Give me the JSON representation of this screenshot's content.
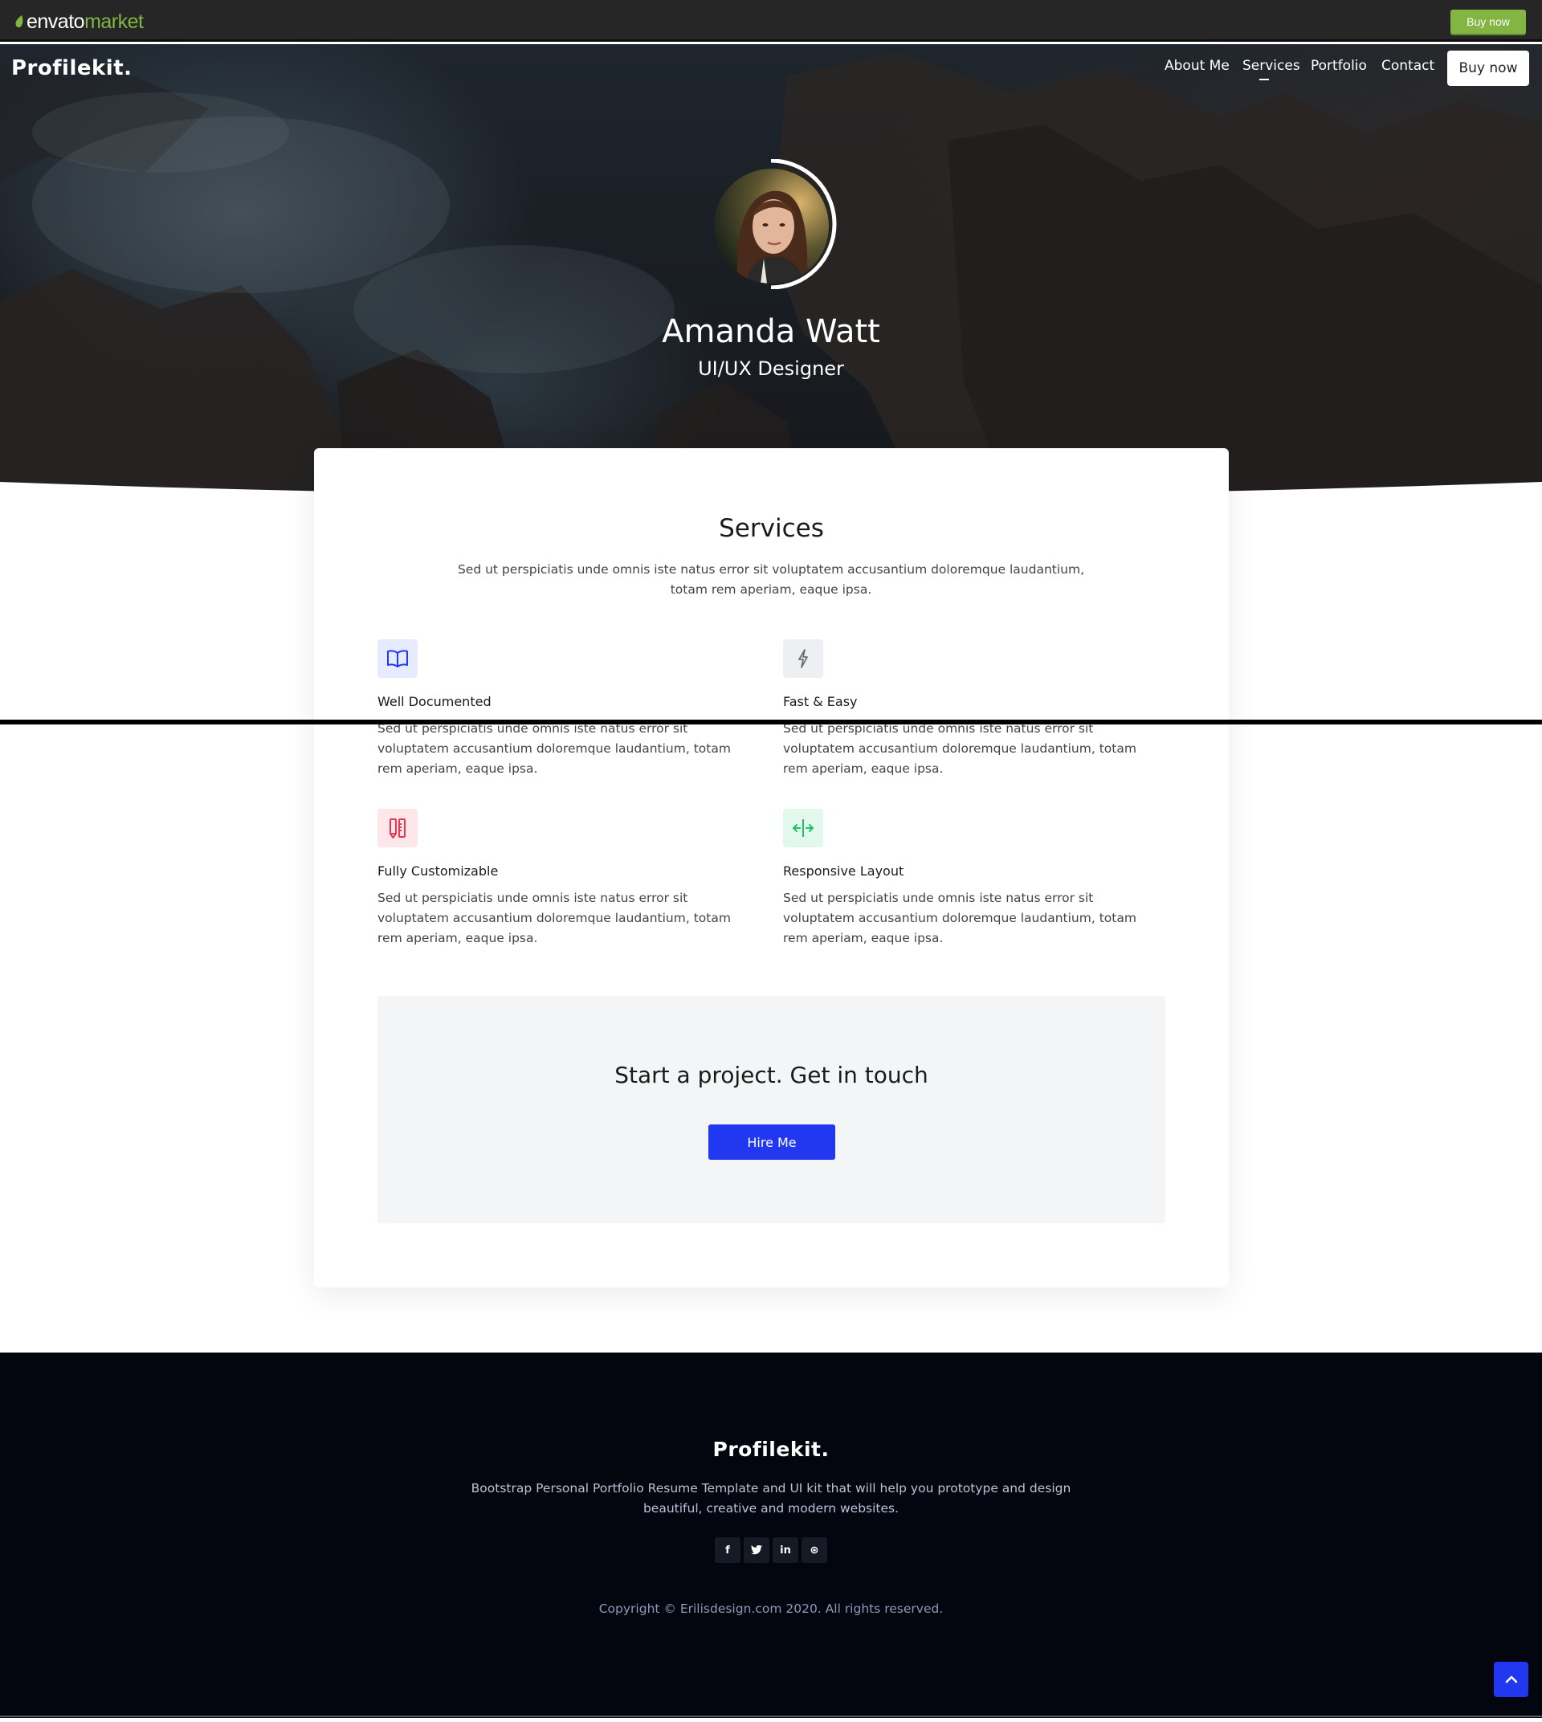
{
  "envato": {
    "logo_word": "envato",
    "logo_market": "market",
    "buy_label": "Buy now",
    "accent": "#82b541"
  },
  "header": {
    "brand": "Profilekit.",
    "nav": [
      {
        "label": "About Me",
        "active": false
      },
      {
        "label": "Services",
        "active": true
      },
      {
        "label": "Portfolio",
        "active": false
      },
      {
        "label": "Contact",
        "active": false
      }
    ],
    "buy_label": "Buy now"
  },
  "hero": {
    "name": "Amanda Watt",
    "role": "UI/UX Designer"
  },
  "services": {
    "title": "Services",
    "description": "Sed ut perspiciatis unde omnis iste natus error sit voluptatem accusantium doloremque laudantium, totam rem aperiam, eaque ipsa.",
    "items": [
      {
        "title": "Well Documented",
        "text": "Sed ut perspiciatis unde omnis iste natus error sit voluptatem accusantium doloremque laudantium, totam rem aperiam, eaque ipsa.",
        "icon": "book-icon",
        "color": "#2138f0"
      },
      {
        "title": "Fast & Easy",
        "text": "Sed ut perspiciatis unde omnis iste natus error sit voluptatem accusantium doloremque laudantium, totam rem aperiam, eaque ipsa.",
        "icon": "lightning-icon",
        "color": "#6b6f78"
      },
      {
        "title": "Fully Customizable",
        "text": "Sed ut perspiciatis unde omnis iste natus error sit voluptatem accusantium doloremque laudantium, totam rem aperiam, eaque ipsa.",
        "icon": "tools-icon",
        "color": "#e8374f"
      },
      {
        "title": "Responsive Layout",
        "text": "Sed ut perspiciatis unde omnis iste natus error sit voluptatem accusantium doloremque laudantium, totam rem aperiam, eaque ipsa.",
        "icon": "arrows-horizontal-icon",
        "color": "#1fc26b"
      }
    ]
  },
  "cta": {
    "title": "Start a project. Get in touch",
    "button": "Hire Me",
    "accent": "#2138f0"
  },
  "footer": {
    "brand": "Profilekit.",
    "description": "Bootstrap Personal Portfolio Resume Template and UI kit that will help you prototype and design beautiful, creative and modern websites.",
    "socials": [
      {
        "icon": "facebook-icon",
        "glyph": "f"
      },
      {
        "icon": "twitter-icon",
        "glyph": "t"
      },
      {
        "icon": "linkedin-icon",
        "glyph": "in"
      },
      {
        "icon": "dribbble-icon",
        "glyph": "⊛"
      }
    ],
    "copyright": "Copyright © Erilisdesign.com 2020. All rights reserved."
  }
}
